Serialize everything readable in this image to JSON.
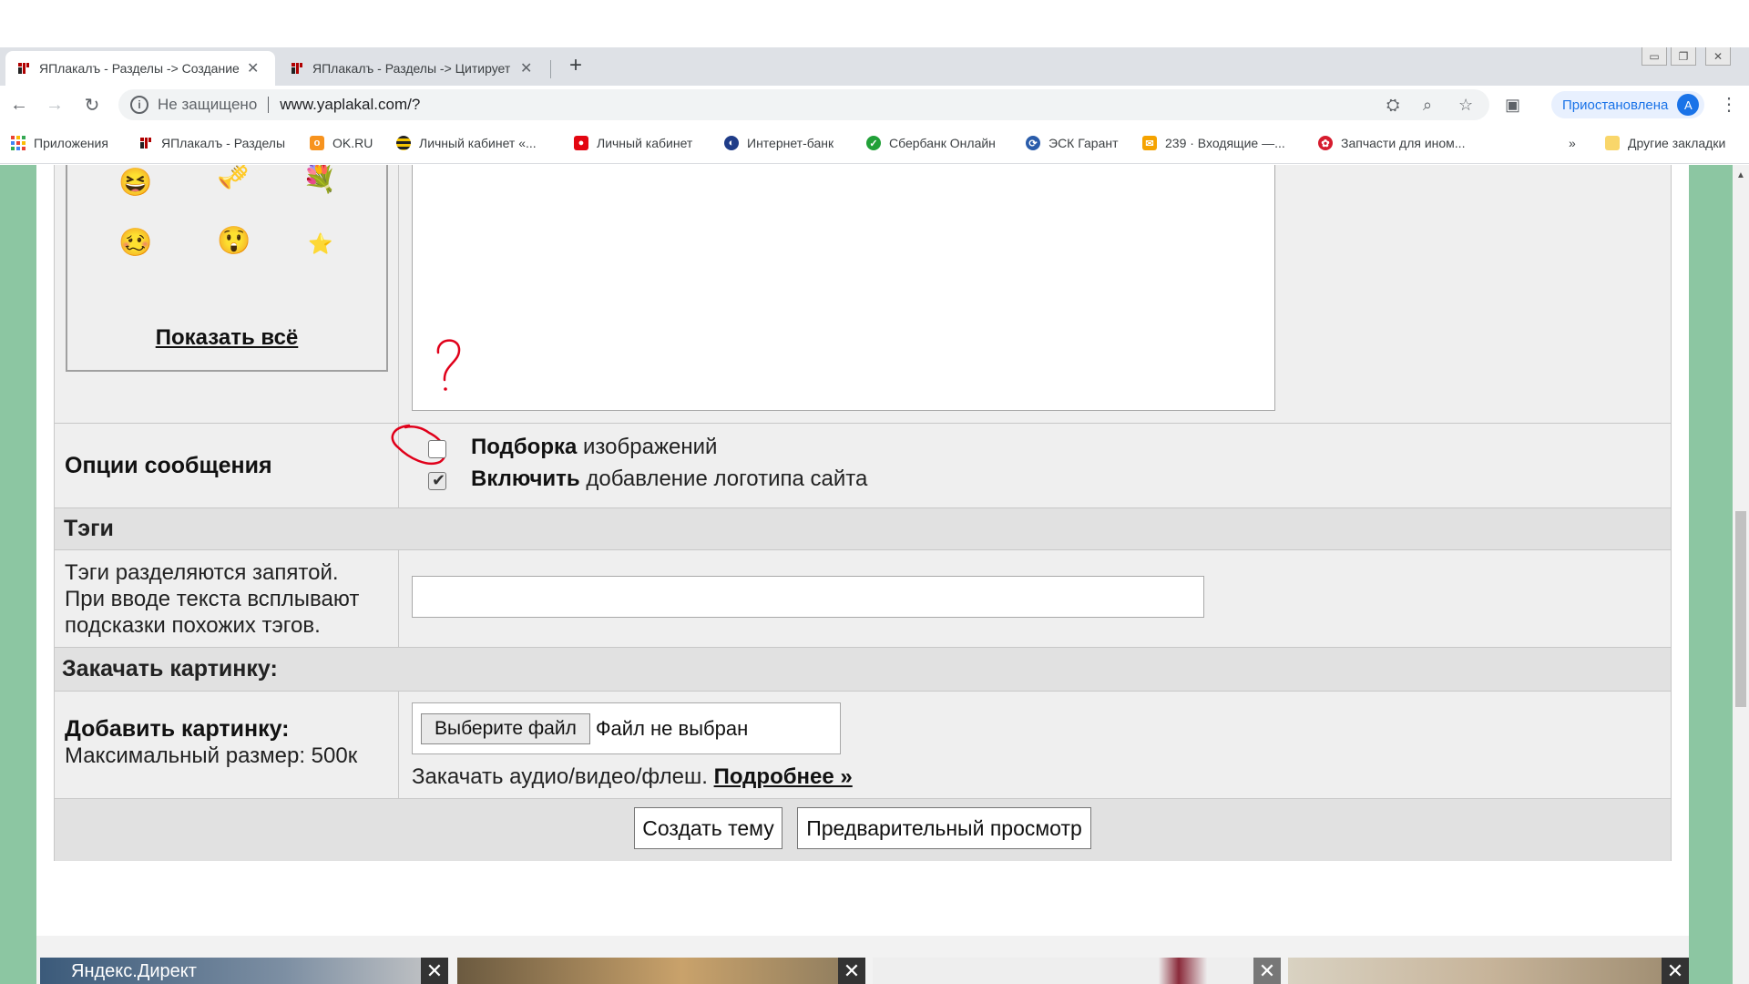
{
  "browser": {
    "tabs": [
      {
        "title": "ЯПлакалъ - Разделы -> Создание",
        "active": true
      },
      {
        "title": "ЯПлакалъ - Разделы -> Цитирует",
        "active": false
      }
    ],
    "address": {
      "security": "Не защищено",
      "url": "www.yaplakal.com/?"
    },
    "profile": {
      "status": "Приостановлена",
      "avatar_letter": "A"
    },
    "bookmarks": [
      {
        "label": "Приложения",
        "icon": "apps-icon"
      },
      {
        "label": "ЯПлакалъ - Разделы",
        "icon": "yaplakal-icon"
      },
      {
        "label": "OK.RU",
        "icon": "ok-icon"
      },
      {
        "label": "Личный кабинет «...",
        "icon": "beeline-icon"
      },
      {
        "label": "Личный кабинет",
        "icon": "mts-icon"
      },
      {
        "label": "Интернет-банк",
        "icon": "bank-icon"
      },
      {
        "label": "Сбербанк Онлайн",
        "icon": "sberbank-icon"
      },
      {
        "label": "ЭСК Гарант",
        "icon": "esk-icon"
      },
      {
        "label": "239 · Входящие —...",
        "icon": "mail-icon"
      },
      {
        "label": "Запчасти для ином...",
        "icon": "parts-icon"
      }
    ],
    "bookmarks_overflow": "»",
    "other_bookmarks": "Другие закладки"
  },
  "form": {
    "show_all": "Показать всё",
    "options": {
      "label": "Опции сообщения",
      "option1_bold": "Подборка",
      "option1_rest": " изображений",
      "option1_checked": false,
      "option2_bold": "Включить",
      "option2_rest": " добавление логотипа сайта",
      "option2_checked": true
    },
    "tags": {
      "header": "Тэги",
      "hint_line1": "Тэги разделяются запятой.",
      "hint_line2": "При вводе текста всплывают",
      "hint_line3": "подсказки похожих тэгов.",
      "value": ""
    },
    "upload": {
      "header": "Закачать картинку:",
      "label": "Добавить картинку:",
      "max_size": "Максимальный размер: 500к",
      "file_button": "Выберите файл",
      "file_status": "Файл не выбран",
      "av_text": "Закачать аудио/видео/флеш. ",
      "more_link": "Подробнее »"
    },
    "buttons": {
      "create": "Создать тему",
      "preview": "Предварительный просмотр"
    }
  },
  "ads": [
    {
      "label": "Яндекс.Директ"
    },
    {
      "label": ""
    },
    {
      "label": ""
    },
    {
      "label": ""
    }
  ],
  "annotation": {
    "mark": "?"
  },
  "colors": {
    "page_bg_side": "#8cc6a2",
    "form_bg": "#efefef",
    "header_bg": "#e1e1e1",
    "annotation": "#e0001a"
  }
}
